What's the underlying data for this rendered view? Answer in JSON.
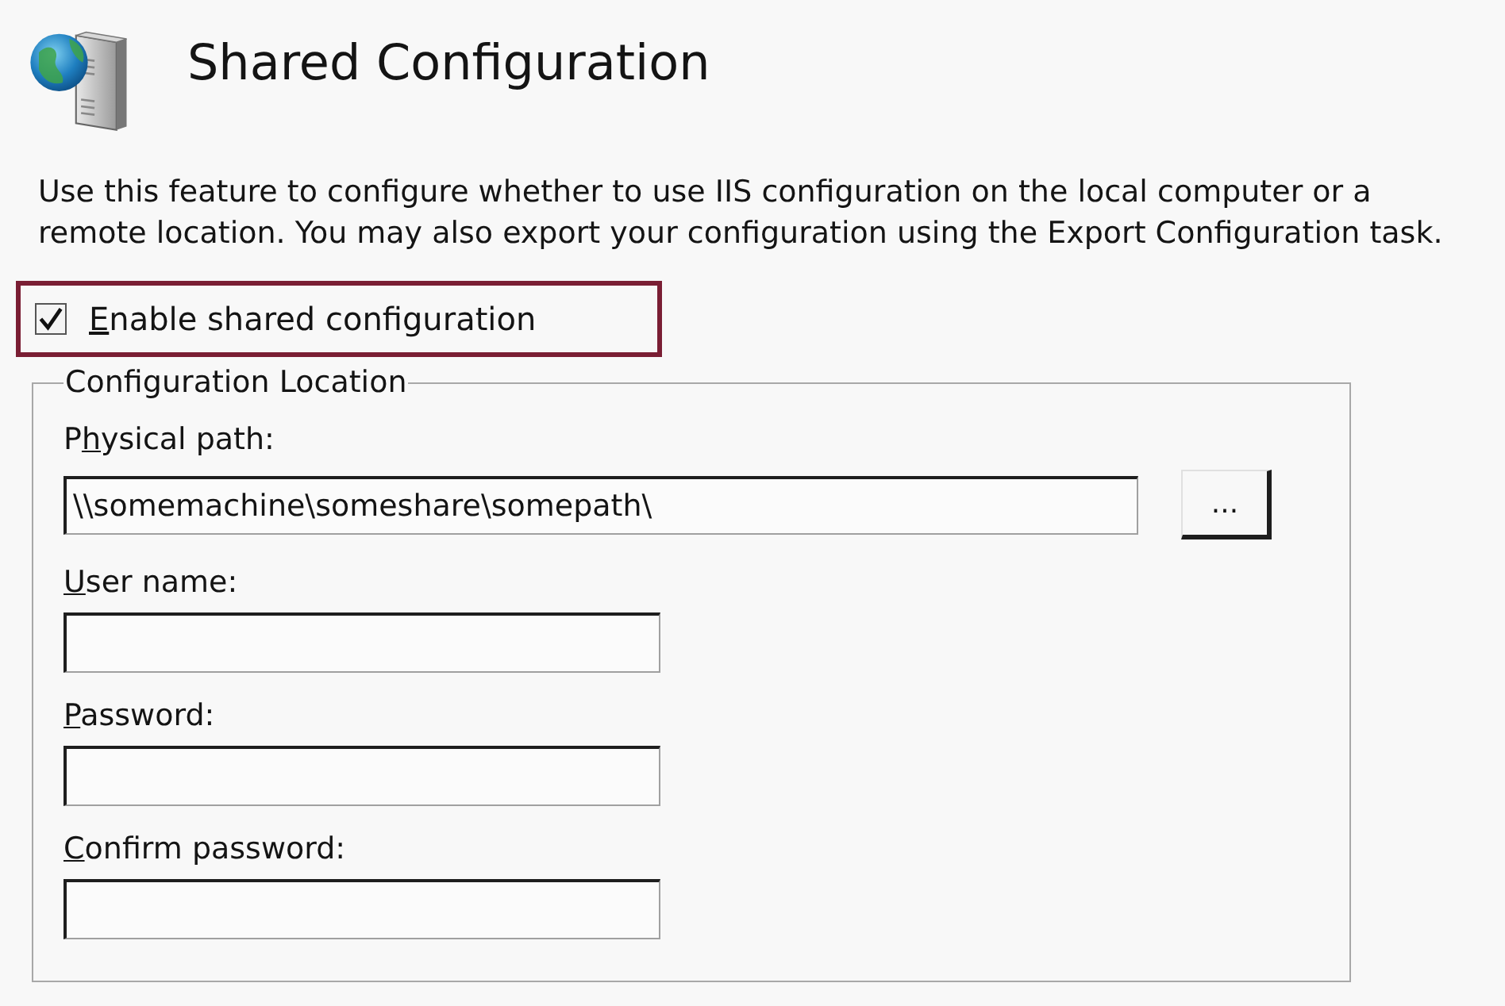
{
  "header": {
    "title": "Shared Configuration"
  },
  "description": "Use this feature to configure whether to use IIS configuration on the local computer or a remote location. You may also export your configuration using the Export Configuration task.",
  "enable_option": {
    "access_key": "E",
    "label_after": "nable shared configuration",
    "checked": true,
    "highlighted": true
  },
  "group": {
    "legend": "Configuration Location",
    "fields": [
      {
        "kind": "path",
        "label_before": "P",
        "access_key": "h",
        "label_after": "ysical path:",
        "value": "\\\\somemachine\\someshare\\somepath\\",
        "browse_button": "..."
      },
      {
        "kind": "text",
        "access_key": "U",
        "label_after": "ser name:"
      },
      {
        "kind": "password",
        "access_key": "P",
        "label_after": "assword:"
      },
      {
        "kind": "password",
        "access_key": "C",
        "label_after": "onfirm password:"
      }
    ]
  }
}
